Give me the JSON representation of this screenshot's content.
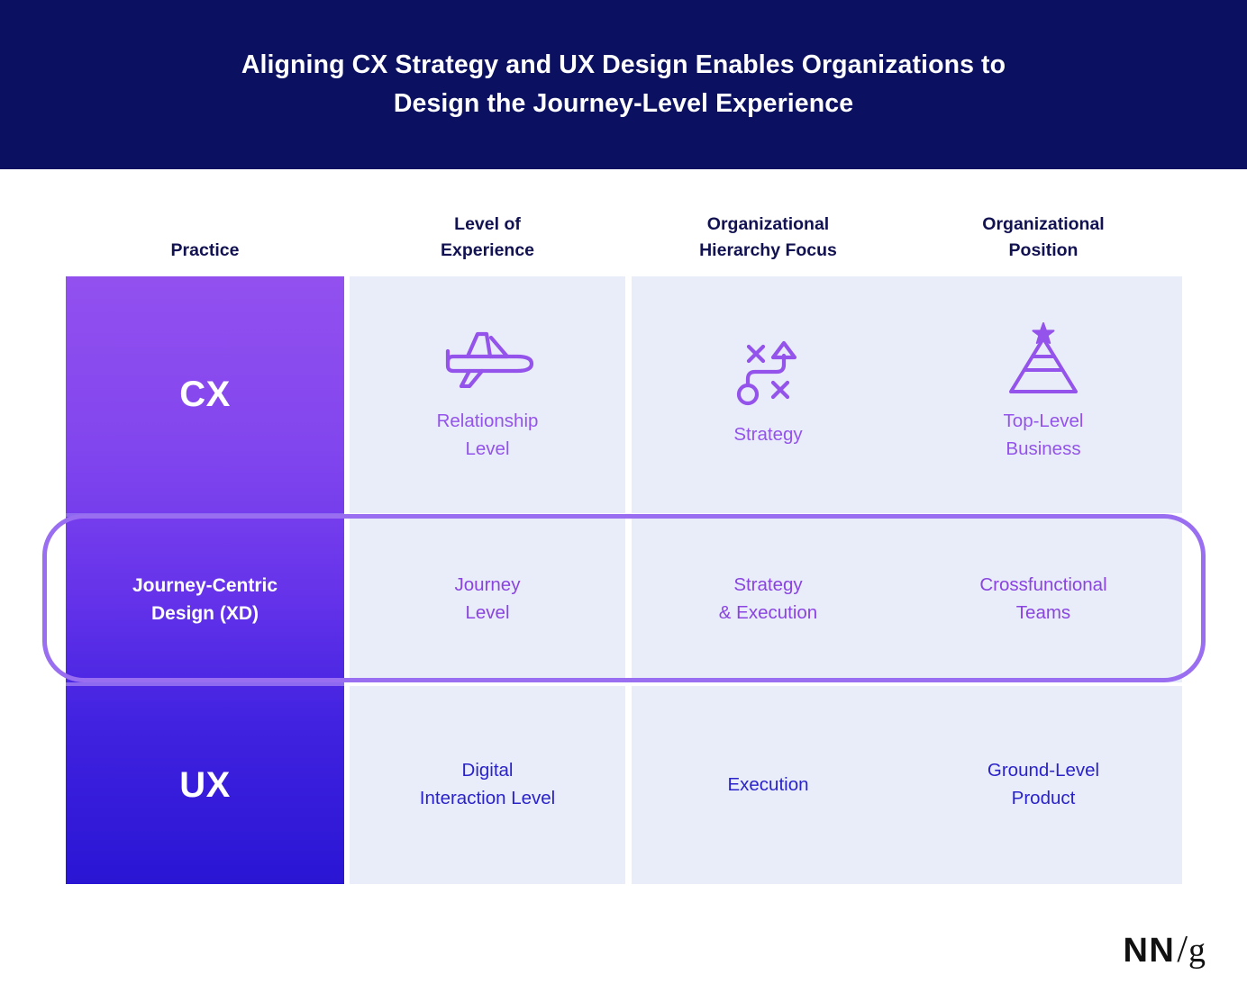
{
  "banner": {
    "title": "Aligning CX Strategy and UX Design Enables Organizations to\nDesign the Journey-Level Experience"
  },
  "colors": {
    "banner_bg": "#0b1060",
    "cell_bg": "#e9edfa",
    "cx_purple": "#9453ea",
    "xd_purple": "#8a44e0",
    "ux_blue": "#2a23c9",
    "header_text": "#121252",
    "highlight_border": "#9a6ef0"
  },
  "table": {
    "headers": [
      "Practice",
      "Level of\nExperience",
      "Organizational\nHierarchy Focus",
      "Organizational\nPosition"
    ],
    "rows": [
      {
        "practice": "CX",
        "highlighted": false,
        "cells": [
          {
            "icon": "airplane-icon",
            "text": "Relationship\nLevel"
          },
          {
            "icon": "strategy-playbook-icon",
            "text": "Strategy"
          },
          {
            "icon": "pyramid-star-icon",
            "text": "Top-Level\nBusiness"
          }
        ]
      },
      {
        "practice": "Journey-Centric\nDesign (XD)",
        "highlighted": true,
        "cells": [
          {
            "icon": "",
            "text": "Journey\nLevel"
          },
          {
            "icon": "",
            "text": "Strategy\n& Execution"
          },
          {
            "icon": "",
            "text": "Crossfunctional\nTeams"
          }
        ]
      },
      {
        "practice": "UX",
        "highlighted": false,
        "cells": [
          {
            "icon": "",
            "text": "Digital\nInteraction Level"
          },
          {
            "icon": "",
            "text": "Execution"
          },
          {
            "icon": "",
            "text": "Ground-Level\nProduct"
          }
        ]
      }
    ]
  },
  "logo": {
    "nn": "NN",
    "slash": "/",
    "g": "g"
  }
}
